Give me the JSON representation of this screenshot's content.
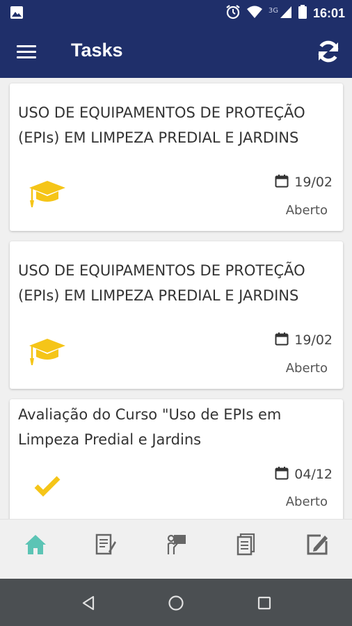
{
  "status_bar": {
    "network_label": "3G",
    "time": "16:01",
    "icons": [
      "image-icon",
      "alarm-icon",
      "wifi-icon",
      "signal-icon",
      "battery-icon"
    ]
  },
  "app_bar": {
    "title": "Tasks",
    "icons": [
      "menu-icon",
      "refresh-icon"
    ]
  },
  "tasks": [
    {
      "title": "USO DE EQUIPAMENTOS DE PROTEÇÃO (EPIs) EM LIMPEZA PREDIAL E JARDINS",
      "date": "19/02",
      "status": "Aberto",
      "type_icon": "graduation-cap-icon"
    },
    {
      "title": "USO DE EQUIPAMENTOS DE PROTEÇÃO (EPIs) EM LIMPEZA PREDIAL E JARDINS",
      "date": "19/02",
      "status": "Aberto",
      "type_icon": "graduation-cap-icon"
    },
    {
      "title": "Avaliação do Curso \"Uso de EPIs em Limpeza Predial e Jardins",
      "date": "04/12",
      "status": "Aberto",
      "type_icon": "checkmark-icon"
    }
  ],
  "bottom_nav": {
    "items": [
      "home-icon",
      "document-edit-icon",
      "presenter-icon",
      "documents-icon",
      "edit-icon"
    ],
    "active": "home-icon"
  },
  "system_nav": {
    "items": [
      "back-icon",
      "home-circle-icon",
      "recents-icon"
    ]
  },
  "colors": {
    "app_bar": "#1f2f6a",
    "accent_yellow": "#f5c518",
    "active_nav": "#5cc4b5",
    "inactive_nav": "#666666",
    "system_nav": "#4b4f52"
  }
}
